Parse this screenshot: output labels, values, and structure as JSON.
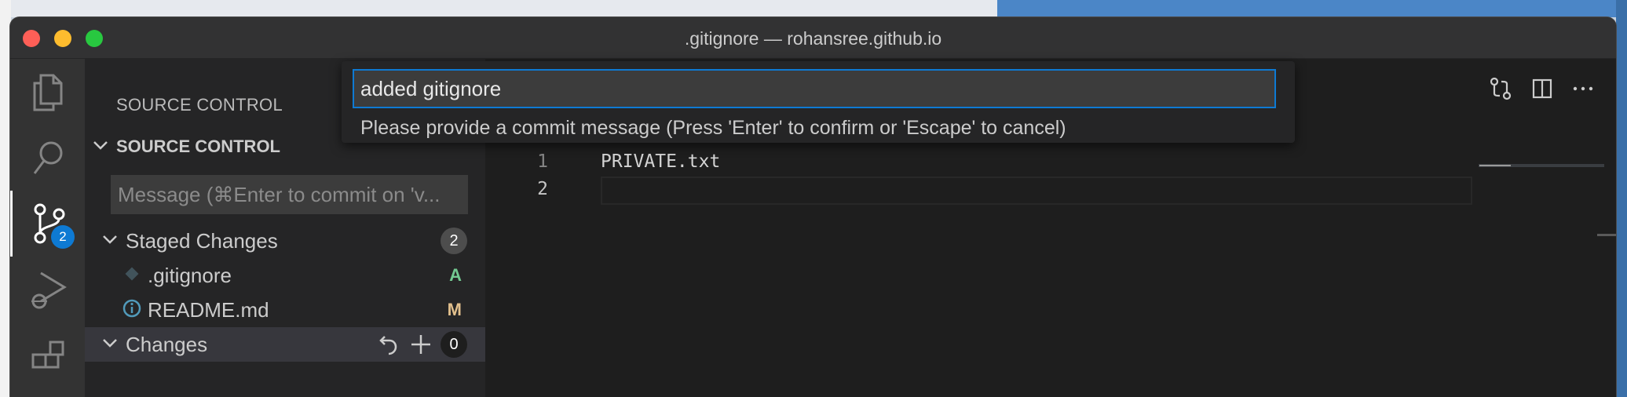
{
  "window": {
    "title": ".gitignore — rohansree.github.io"
  },
  "activity_bar": {
    "items": [
      {
        "name": "explorer",
        "icon": "files-icon"
      },
      {
        "name": "search",
        "icon": "search-icon"
      },
      {
        "name": "source-control",
        "icon": "source-control-icon",
        "badge": "2"
      },
      {
        "name": "run-debug",
        "icon": "run-debug-icon"
      },
      {
        "name": "extensions",
        "icon": "extensions-icon"
      }
    ]
  },
  "sidebar": {
    "header": "SOURCE CONTROL",
    "section_title": "SOURCE CONTROL",
    "message_placeholder": "Message (⌘Enter to commit on 'v...",
    "staged": {
      "label": "Staged Changes",
      "count": "2",
      "files": [
        {
          "name": ".gitignore",
          "status": "A",
          "status_color": "#73c991",
          "icon": "git-diamond-icon"
        },
        {
          "name": "README.md",
          "status": "M",
          "status_color": "#e2c08d",
          "icon": "info-icon"
        }
      ]
    },
    "changes": {
      "label": "Changes",
      "count": "0"
    }
  },
  "editor": {
    "lines": [
      {
        "number": "1",
        "text": "PRIVATE.txt"
      },
      {
        "number": "2",
        "text": ""
      }
    ]
  },
  "quick_input": {
    "value": "added gitignore",
    "message": "Please provide a commit message (Press 'Enter' to confirm or 'Escape' to cancel)"
  },
  "colors": {
    "accent": "#0e7ad3",
    "added": "#73c991",
    "modified": "#e2c08d"
  }
}
